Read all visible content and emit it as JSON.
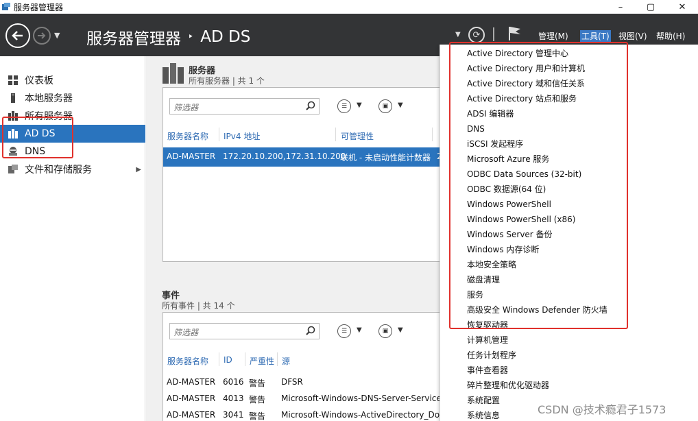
{
  "window": {
    "title": "服务器管理器",
    "minimize": "–",
    "maximize": "▢",
    "close": "✕"
  },
  "header": {
    "breadcrumb_root": "服务器管理器",
    "breadcrumb_sep": "‣",
    "breadcrumb_current": "AD DS",
    "menus": [
      "管理(M)",
      "工具(T)",
      "视图(V)",
      "帮助(H)"
    ]
  },
  "sidebar": {
    "items": [
      {
        "label": "仪表板"
      },
      {
        "label": "本地服务器"
      },
      {
        "label": "所有服务器"
      },
      {
        "label": "AD DS"
      },
      {
        "label": "DNS"
      },
      {
        "label": "文件和存储服务"
      }
    ]
  },
  "servers": {
    "title": "服务器",
    "subtitle": "所有服务器 | 共 1 个",
    "filter_placeholder": "筛选器",
    "columns": [
      "服务器名称",
      "IPv4 地址",
      "可管理性",
      ""
    ],
    "rows": [
      {
        "name": "AD-MASTER",
        "ipv4": "172.20.10.200,172.31.10.200",
        "manageability": "联机 - 未启动性能计数器",
        "extra": "2"
      }
    ]
  },
  "events": {
    "title": "事件",
    "subtitle": "所有事件 | 共 14 个",
    "filter_placeholder": "筛选器",
    "columns": [
      "服务器名称",
      "ID",
      "严重性",
      "源"
    ],
    "rows": [
      {
        "server": "AD-MASTER",
        "id": "6016",
        "severity": "警告",
        "source": "DFSR"
      },
      {
        "server": "AD-MASTER",
        "id": "4013",
        "severity": "警告",
        "source": "Microsoft-Windows-DNS-Server-Service"
      },
      {
        "server": "AD-MASTER",
        "id": "3041",
        "severity": "警告",
        "source": "Microsoft-Windows-ActiveDirectory_Do"
      }
    ]
  },
  "tools_menu": {
    "items": [
      "Active Directory 管理中心",
      "Active Directory 用户和计算机",
      "Active Directory 域和信任关系",
      "Active Directory 站点和服务",
      "ADSI 编辑器",
      "DNS",
      "iSCSI 发起程序",
      "Microsoft Azure 服务",
      "ODBC Data Sources (32-bit)",
      "ODBC 数据源(64 位)",
      "Windows PowerShell",
      "Windows PowerShell (x86)",
      "Windows Server 备份",
      "Windows 内存诊断",
      "本地安全策略",
      "磁盘清理",
      "服务",
      "高级安全 Windows Defender 防火墙",
      "恢复驱动器",
      "计算机管理",
      "任务计划程序",
      "事件查看器",
      "碎片整理和优化驱动器",
      "系统配置",
      "系统信息"
    ]
  },
  "watermark": "CSDN @技术瘾君子1573",
  "colors": {
    "header_bg": "#333436",
    "accent": "#2a74be",
    "highlight_box": "#e0312c"
  }
}
